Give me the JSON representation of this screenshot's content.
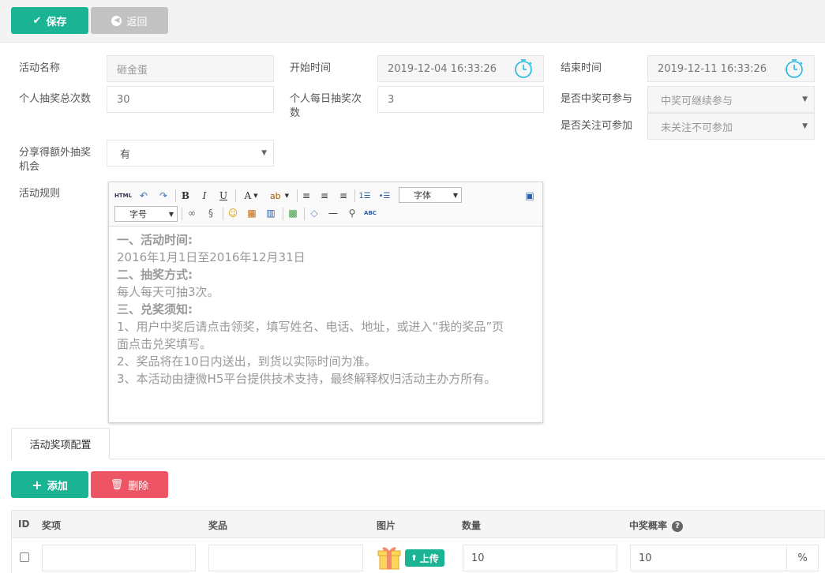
{
  "toolbar": {
    "save_label": "保存",
    "back_label": "返回"
  },
  "form": {
    "activity_name": {
      "label": "活动名称",
      "value": "砸金蛋"
    },
    "start_time": {
      "label": "开始时间",
      "value": "2019-12-04 16:33:26"
    },
    "end_time": {
      "label": "结束时间",
      "value": "2019-12-11 16:33:26"
    },
    "total_draws": {
      "label": "个人抽奖总次数",
      "value": "30"
    },
    "daily_draws": {
      "label": "个人每日抽奖次数",
      "value": "3"
    },
    "after_win": {
      "label": "是否中奖可参与",
      "value": "中奖可继续参与"
    },
    "follow_required": {
      "label": "是否关注可参加",
      "value": "未关注不可参加"
    },
    "share_extra": {
      "label": "分享得额外抽奖机会",
      "value": "有"
    },
    "rules": {
      "label": "活动规则"
    }
  },
  "editor": {
    "font_family": "字体",
    "font_size": "字号",
    "content": [
      {
        "text": "一、活动时间:",
        "bold": true
      },
      {
        "text": "2016年1月1日至2016年12月31日",
        "bold": false
      },
      {
        "text": "二、抽奖方式:",
        "bold": true
      },
      {
        "text": "每人每天可抽3次。",
        "bold": false
      },
      {
        "text": "三、兑奖须知:",
        "bold": true
      },
      {
        "text": "1、用户中奖后请点击领奖，填写姓名、电话、地址，或进入“我的奖品”页面点击兑奖填写。",
        "bold": false
      },
      {
        "text": "2、奖品将在10日内送出，到货以实际时间为准。",
        "bold": false
      },
      {
        "text": "3、本活动由捷微H5平台提供技术支持，最终解释权归活动主办方所有。",
        "bold": false
      }
    ]
  },
  "tabs": {
    "prize_config": "活动奖项配置"
  },
  "actions": {
    "add_label": "添加",
    "delete_label": "删除"
  },
  "table": {
    "headers": {
      "id": "ID",
      "award": "奖项",
      "prize": "奖品",
      "image": "图片",
      "quantity": "数量",
      "probability": "中奖概率"
    },
    "rows": [
      {
        "award": "",
        "prize": "",
        "upload_label": "上传",
        "quantity": "10",
        "probability": "10",
        "unit": "%"
      }
    ]
  },
  "colors": {
    "primary": "#1ab394",
    "danger": "#ed5565",
    "disabled": "#c2c2c2",
    "clock": "#23b7e5"
  }
}
